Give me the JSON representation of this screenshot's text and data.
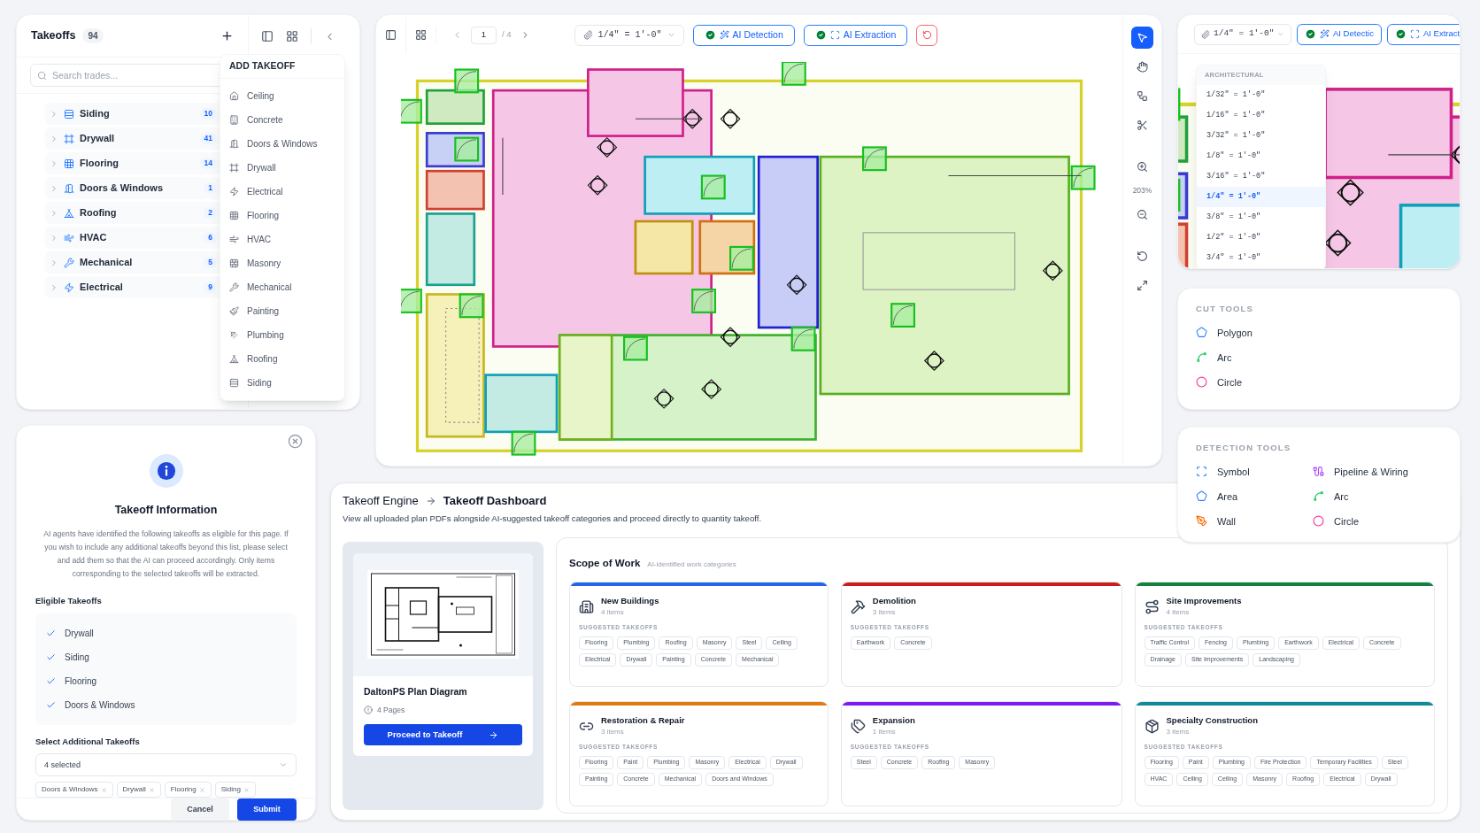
{
  "takeoffs_panel": {
    "title": "Takeoffs",
    "count": "94",
    "search": {
      "placeholder": "Search trades..."
    },
    "trades": [
      {
        "label": "Siding",
        "count": "10",
        "kind": "siding"
      },
      {
        "label": "Drywall",
        "count": "41",
        "kind": "drywall"
      },
      {
        "label": "Flooring",
        "count": "14",
        "kind": "flooring"
      },
      {
        "label": "Doors & Windows",
        "count": "1",
        "kind": "doors_windows"
      },
      {
        "label": "Roofing",
        "count": "2",
        "kind": "roofing"
      },
      {
        "label": "HVAC",
        "count": "6",
        "kind": "hvac"
      },
      {
        "label": "Mechanical",
        "count": "5",
        "kind": "mechanical"
      },
      {
        "label": "Electrical",
        "count": "9",
        "kind": "electrical"
      }
    ]
  },
  "add_takeoff_menu": {
    "title": "ADD TAKEOFF",
    "items": [
      {
        "label": "Ceiling",
        "kind": "ceiling"
      },
      {
        "label": "Concrete",
        "kind": "concrete"
      },
      {
        "label": "Doors & Windows",
        "kind": "doors_windows"
      },
      {
        "label": "Drywall",
        "kind": "drywall"
      },
      {
        "label": "Electrical",
        "kind": "electrical"
      },
      {
        "label": "Flooring",
        "kind": "flooring"
      },
      {
        "label": "HVAC",
        "kind": "hvac"
      },
      {
        "label": "Masonry",
        "kind": "masonry"
      },
      {
        "label": "Mechanical",
        "kind": "mechanical"
      },
      {
        "label": "Painting",
        "kind": "painting"
      },
      {
        "label": "Plumbing",
        "kind": "plumbing"
      },
      {
        "label": "Roofing",
        "kind": "roofing"
      },
      {
        "label": "Siding",
        "kind": "siding"
      }
    ]
  },
  "takeoff_info_dialog": {
    "title": "Takeoff Information",
    "description": "AI agents have identified the following takeoffs as eligible for this page. If you wish to include any additional takeoffs beyond this list, please select and add them so that the AI can proceed accordingly. Only items corresponding to the selected takeoffs will be extracted.",
    "eligible_title": "Eligible Takeoffs",
    "eligible": [
      {
        "label": "Drywall",
        "checked": true
      },
      {
        "label": "Siding",
        "checked": true
      },
      {
        "label": "Flooring",
        "checked": true
      },
      {
        "label": "Doors & Windows",
        "checked": true
      }
    ],
    "additional_title": "Select Additional Takeoffs",
    "select_value": "4 selected",
    "chips": [
      "Doors & Windows",
      "Drywall",
      "Flooring",
      "Siding"
    ],
    "cancel": "Cancel",
    "submit": "Submit"
  },
  "plan_viewer": {
    "page": "1",
    "page_total": "/ 4",
    "scale": "1/4\" = 1'-0\"",
    "ai_buttons": [
      {
        "label": "AI Detection",
        "checked": true,
        "kind": "detection"
      },
      {
        "label": "AI Extraction",
        "checked": true,
        "kind": "extraction"
      }
    ],
    "tools": [
      {
        "kind": "select",
        "selected": true
      },
      {
        "kind": "pan",
        "selected": false
      },
      {
        "kind": "nodes",
        "selected": false
      },
      {
        "kind": "cut",
        "selected": false
      },
      {
        "kind": "zoom_in",
        "selected": false
      },
      {
        "kind": "zoom_out",
        "selected": false
      },
      {
        "kind": "rotate",
        "selected": false
      },
      {
        "kind": "fit",
        "selected": false
      }
    ],
    "zoom": "203%"
  },
  "scale_preview": {
    "scale": "1/4\" = 1'-0\"",
    "ai_buttons": [
      {
        "label": "AI Detectic",
        "checked": true,
        "kind": "detection"
      },
      {
        "label": "AI Extract",
        "checked": true,
        "kind": "extraction"
      }
    ],
    "dropdown": {
      "header": "ARCHITECTURAL",
      "options": [
        {
          "label": "1/32\" = 1'-0\"",
          "selected": false
        },
        {
          "label": "1/16\" = 1'-0\"",
          "selected": false
        },
        {
          "label": "3/32\" = 1'-0\"",
          "selected": false
        },
        {
          "label": "1/8\" = 1'-0\"",
          "selected": false
        },
        {
          "label": "3/16\" = 1'-0\"",
          "selected": false
        },
        {
          "label": "1/4\" = 1'-0\"",
          "selected": true
        },
        {
          "label": "3/8\" = 1'-0\"",
          "selected": false
        },
        {
          "label": "1/2\" = 1'-0\"",
          "selected": false
        },
        {
          "label": "3/4\" = 1'-0\"",
          "selected": false
        }
      ]
    }
  },
  "cut_tools": {
    "title": "CUT TOOLS",
    "items": [
      {
        "label": "Polygon",
        "kind": "polygon"
      },
      {
        "label": "Arc",
        "kind": "arc"
      },
      {
        "label": "Circle",
        "kind": "circle"
      }
    ]
  },
  "detection_tools": {
    "title": "DETECTION TOOLS",
    "items": [
      {
        "label": "Symbol",
        "kind": "symbol"
      },
      {
        "label": "Pipeline & Wiring",
        "kind": "pipeline"
      },
      {
        "label": "Area",
        "kind": "area"
      },
      {
        "label": "Arc",
        "kind": "arc"
      },
      {
        "label": "Wall",
        "kind": "wall"
      },
      {
        "label": "Circle",
        "kind": "circle"
      }
    ]
  },
  "dashboard": {
    "breadcrumb": [
      "Takeoff Engine",
      "Takeoff Dashboard"
    ],
    "description": "View all uploaded plan PDFs alongside AI-suggested takeoff categories and proceed directly to quantity takeoff.",
    "plan": {
      "name": "DaltonPS Plan Diagram",
      "pages": "4 Pages",
      "button": "Proceed to Takeoff"
    },
    "scope": {
      "title": "Scope of Work",
      "subtitle": "AI-identified work categories",
      "categories": [
        {
          "name": "New Buildings",
          "count": "4 items",
          "color": "#2563eb",
          "kind": "building",
          "label": "SUGGESTED TAKEOFFS",
          "takeoffs": [
            "Flooring",
            "Plumbing",
            "Roofing",
            "Masonry",
            "Steel",
            "Ceiling",
            "Electrical",
            "Drywall",
            "Painting",
            "Concrete",
            "Mechanical"
          ]
        },
        {
          "name": "Demolition",
          "count": "3 items",
          "color": "#c81e1e",
          "kind": "demolition",
          "label": "SUGGESTED TAKEOFFS",
          "takeoffs": [
            "Earthwork",
            "Concrete"
          ]
        },
        {
          "name": "Site Improvements",
          "count": "4 items",
          "color": "#15803d",
          "kind": "site",
          "label": "SUGGESTED TAKEOFFS",
          "takeoffs": [
            "Traffic Control",
            "Fencing",
            "Plumbing",
            "Earthwork",
            "Electrical",
            "Concrete",
            "Drainage",
            "Site Improvements",
            "Landscaping"
          ]
        },
        {
          "name": "Restoration & Repair",
          "count": "3 items",
          "color": "#e07b12",
          "kind": "restoration",
          "label": "SUGGESTED TAKEOFFS",
          "takeoffs": [
            "Flooring",
            "Paint",
            "Plumbing",
            "Masonry",
            "Electrical",
            "Drywall",
            "Painting",
            "Concrete",
            "Mechanical",
            "Doors and Windows"
          ]
        },
        {
          "name": "Expansion",
          "count": "1 items",
          "color": "#7c1cf0",
          "kind": "expansion",
          "label": "SUGGESTED TAKEOFFS",
          "takeoffs": [
            "Steel",
            "Concrete",
            "Roofing",
            "Masonry"
          ]
        },
        {
          "name": "Specialty Construction",
          "count": "3 items",
          "color": "#0f8a9a",
          "kind": "specialty",
          "label": "SUGGESTED TAKEOFFS",
          "takeoffs": [
            "Flooring",
            "Paint",
            "Plumbing",
            "Fire Protection",
            "Temporary Facilities",
            "Steel",
            "HVAC",
            "Ceiling",
            "Ceiling",
            "Masonry",
            "Roofing",
            "Electrical",
            "Drywall"
          ]
        }
      ]
    }
  }
}
